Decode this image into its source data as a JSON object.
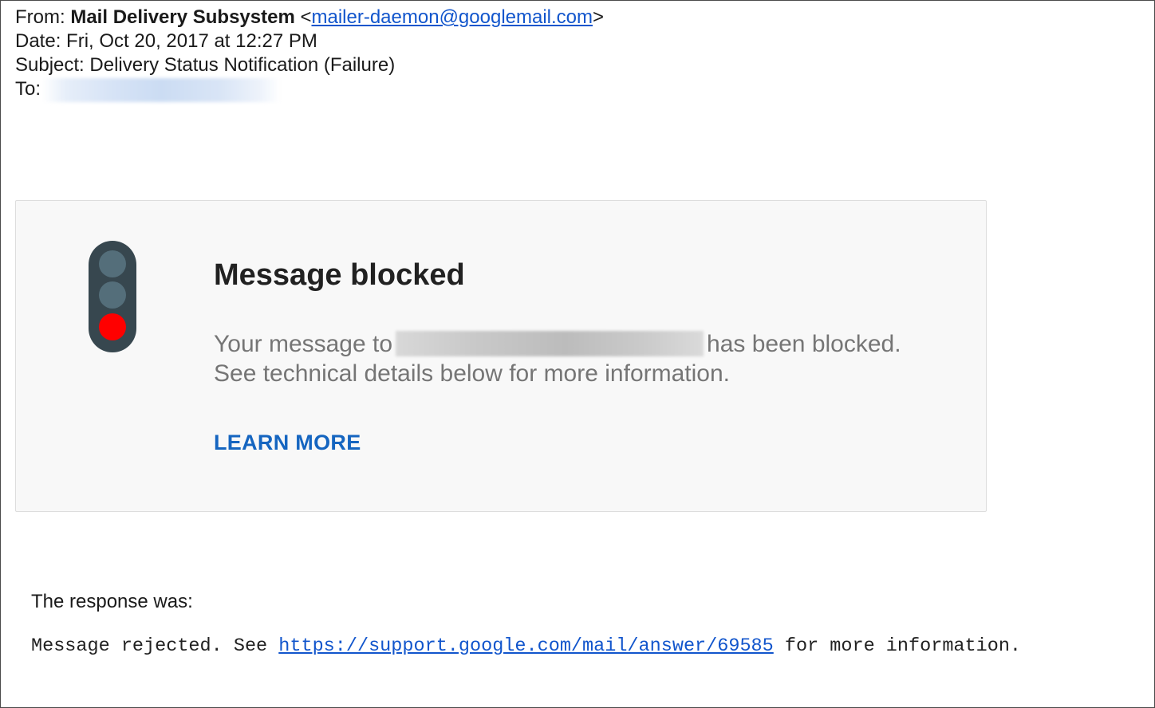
{
  "header": {
    "from_label": "From:",
    "sender_name": "Mail Delivery Subsystem",
    "sender_email": "mailer-daemon@googlemail.com",
    "date_label": "Date:",
    "date_value": "Fri, Oct 20, 2017 at 12:27 PM",
    "subject_label": "Subject:",
    "subject_value": "Delivery Status Notification (Failure)",
    "to_label": "To:"
  },
  "card": {
    "icon": "traffic-light-red-icon",
    "title": "Message blocked",
    "body_prefix": "Your message to",
    "body_suffix": "has been blocked.",
    "body_line2": "See technical details below for more information.",
    "learn_more": "LEARN MORE"
  },
  "response": {
    "label": "The response was:",
    "message_prefix": "Message rejected. See",
    "link": "https://support.google.com/mail/answer/69585",
    "message_suffix": "for more information."
  },
  "colors": {
    "link": "#1155cc",
    "learn_more": "#1565c0",
    "traffic_light_body": "#37474f",
    "lamp_off": "#546e7a",
    "lamp_red": "#ff0000"
  }
}
